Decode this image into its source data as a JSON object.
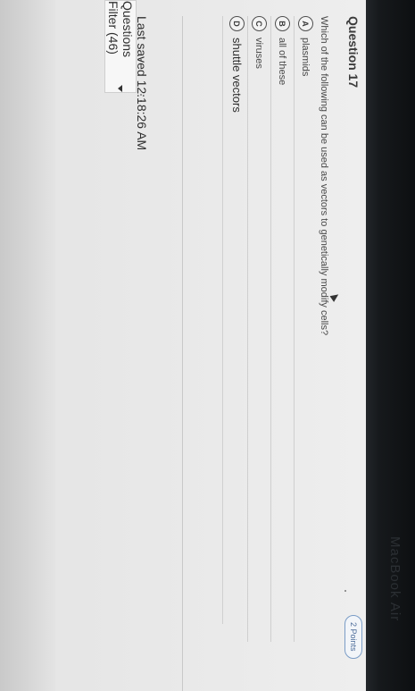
{
  "question": {
    "title": "Question 17",
    "points": "2 Points",
    "prompt": "Which of the following can be used as vectors to genetically modify cells?",
    "options": [
      {
        "letter": "A",
        "text": "plasmids"
      },
      {
        "letter": "B",
        "text": "all of these"
      },
      {
        "letter": "C",
        "text": "viruses"
      },
      {
        "letter": "D",
        "text": "shuttle vectors"
      }
    ]
  },
  "footer": {
    "last_saved": "Last saved 12:18:26 AM",
    "filter_label": "Questions Filter (46)"
  },
  "device": {
    "brand": "MacBook Air"
  },
  "colors": {
    "background_dark": "#101214",
    "card": "#eeeeee",
    "badge_border": "#7a9cc6",
    "text": "#3c3c3c"
  },
  "icons": {
    "filter_caret": "chevron-down-icon",
    "cursor": "pointer-cursor-icon"
  }
}
